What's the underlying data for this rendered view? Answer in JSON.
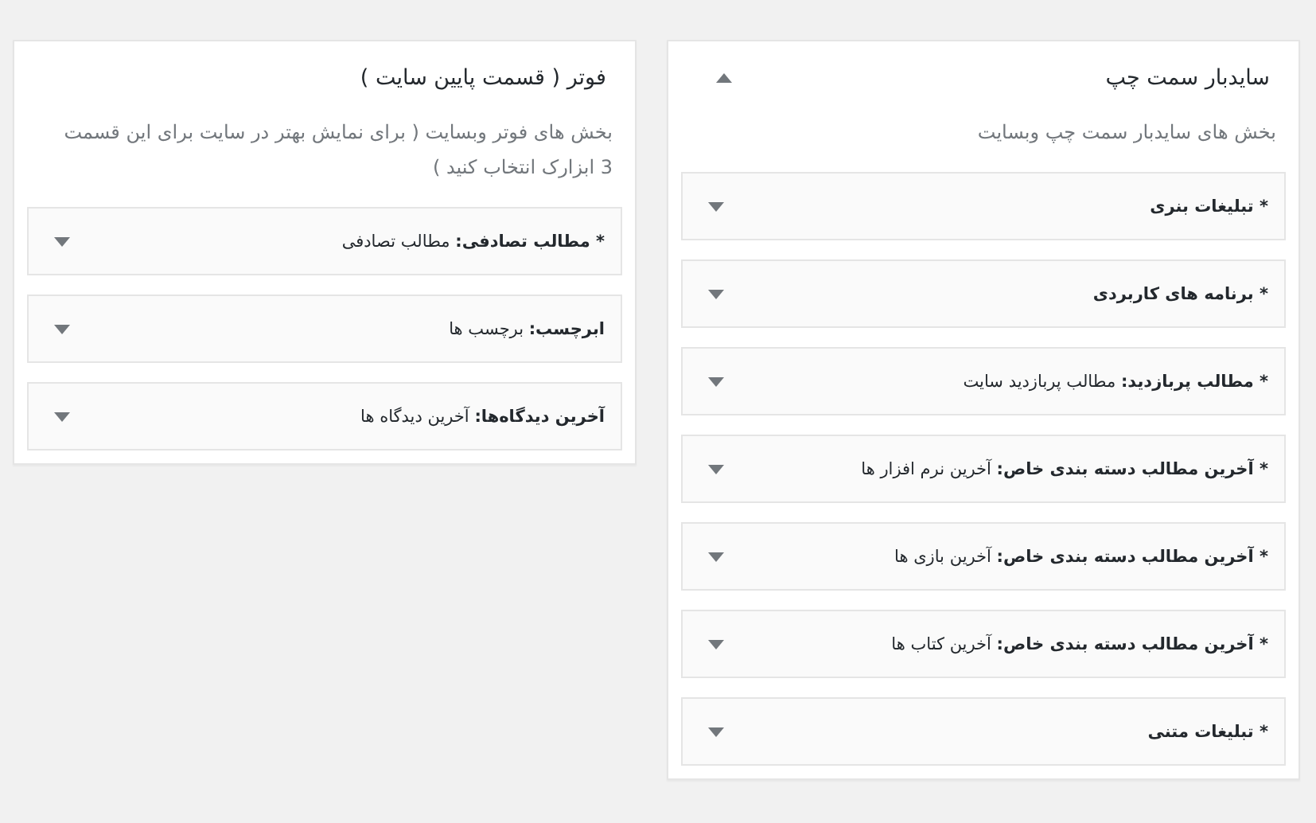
{
  "panels": [
    {
      "title": "سایدبار سمت چپ",
      "description": "بخش های سایدبار سمت چپ وبسایت",
      "expanded": true,
      "widgets": [
        {
          "kind": "bold",
          "label": "* تبلیغات بنری",
          "expanded": false
        },
        {
          "kind": "bold",
          "label": "* برنامه های کاربردی",
          "expanded": false
        },
        {
          "kind": "mixed",
          "label": "*** مطالب پربازدید:** مطالب پربازدید سایت",
          "expanded": false
        },
        {
          "kind": "mixed",
          "label": "*** آخرین مطالب دسته بندی خاص:** آخرین نرم افزار ها",
          "expanded": false
        },
        {
          "kind": "mixed",
          "label": "*** آخرین مطالب دسته بندی خاص:** آخرین بازی ها",
          "expanded": false
        },
        {
          "kind": "mixed",
          "label": "*** آخرین مطالب دسته بندی خاص:** آخرین کتاب ها",
          "expanded": false
        },
        {
          "kind": "bold",
          "label": "* تبلیغات متنی",
          "expanded": false
        }
      ]
    },
    {
      "title": "فوتر ( قسمت پایین سایت )",
      "description": "بخش های فوتر وبسایت ( برای نمایش بهتر در سایت برای این قسمت 3 ابزارک انتخاب کنید )",
      "widgets": [
        {
          "kind": "mixed",
          "label": "*** مطالب تصادفی:** مطالب تصادفی",
          "expanded": false
        },
        {
          "kind": "mixed",
          "label": "**ابرچسب:** برچسب ها",
          "expanded": false
        },
        {
          "kind": "mixed",
          "label": "**آخرین دیدگاه‌ها:** آخرین دیدگاه ها",
          "expanded": false
        }
      ]
    }
  ]
}
